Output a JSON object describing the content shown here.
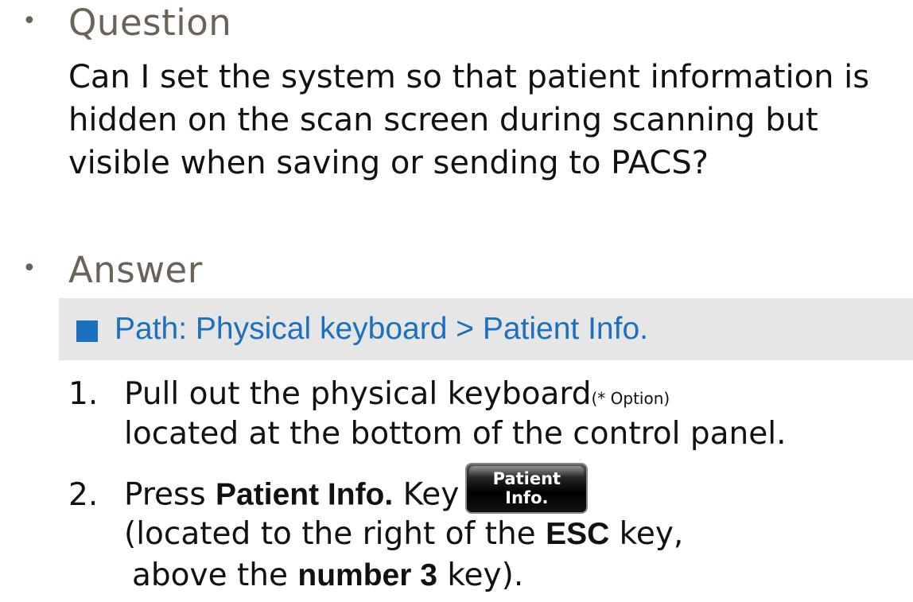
{
  "question": {
    "bullet": "•",
    "heading": "Question",
    "text": "Can I set the system so that patient information is hidden on the scan screen during scanning but visible when saving or sending to PACS?"
  },
  "answer": {
    "bullet": "•",
    "heading": "Answer",
    "path": "Path: Physical keyboard > Patient Info.",
    "path_color": "#1c70c2",
    "steps": [
      {
        "number": "1.",
        "line1_text": "Pull out the physical keyboard",
        "line1_note": "(* Option)",
        "line2_text": "located at the bottom of the control panel."
      },
      {
        "number": "2.",
        "press": "Press ",
        "key_name": "Patient Info.",
        "key_word": " Key",
        "key_icon": {
          "line1": "Patient",
          "line2": "Info."
        },
        "line2_pre": "(located to the right of the ",
        "line2_bold": "ESC",
        "line2_post": " key,",
        "line3_pre": "above the ",
        "line3_bold": "number 3",
        "line3_post": " key)."
      }
    ]
  }
}
